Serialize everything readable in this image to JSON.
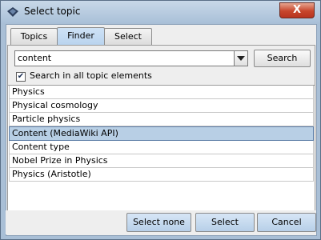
{
  "window": {
    "title": "Select topic",
    "close_label": "X"
  },
  "tabs": [
    {
      "label": "Topics"
    },
    {
      "label": "Finder"
    },
    {
      "label": "Select"
    }
  ],
  "finder": {
    "search_value": "content",
    "search_button": "Search",
    "checkbox_label": "Search in all topic elements",
    "checkbox_checked": true
  },
  "results": [
    {
      "label": "Physics"
    },
    {
      "label": "Physical cosmology"
    },
    {
      "label": "Particle physics"
    },
    {
      "label": "Content (MediaWiki API)"
    },
    {
      "label": "Content type"
    },
    {
      "label": "Nobel Prize in Physics"
    },
    {
      "label": "Physics (Aristotle)"
    }
  ],
  "selected_result": "Content (MediaWiki API)",
  "footer": {
    "select_none": "Select none",
    "select": "Select",
    "cancel": "Cancel"
  }
}
